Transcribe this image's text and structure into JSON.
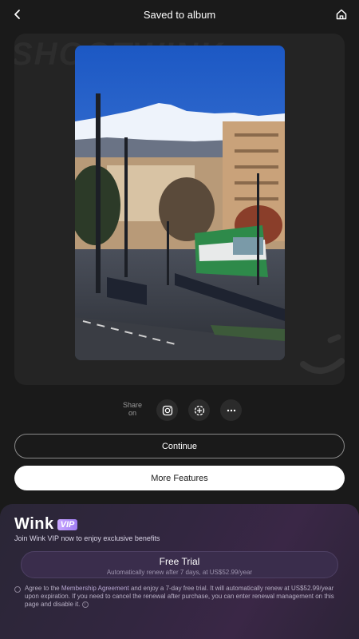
{
  "header": {
    "title": "Saved to album",
    "back_icon": "chevron-left-icon",
    "home_icon": "home-icon"
  },
  "preview": {
    "watermark": "SHOOTWINK"
  },
  "share": {
    "label": "Share on",
    "icons": [
      "instagram-icon",
      "story-icon",
      "more-icon"
    ]
  },
  "actions": {
    "continue_label": "Continue",
    "more_features_label": "More Features"
  },
  "vip": {
    "brand": "Wink",
    "badge": "VIP",
    "subtitle": "Join Wink VIP now to enjoy exclusive benefits",
    "trial_title": "Free Trial",
    "trial_note": "Automatically renew after 7 days, at US$52.99/year",
    "agree_prefix": "Agree to the ",
    "agree_link": "Membership Agreement",
    "agree_suffix": " and enjoy a 7-day free trial. It will automatically renew at US$52.99/year upon expiration. If you need to cancel the renewal after purchase, you can enter renewal management on this page and disable it.",
    "info_icon": "i"
  },
  "colors": {
    "background": "#1a1a1a",
    "card": "#242424",
    "vip_accent": "#9f7cf2"
  }
}
